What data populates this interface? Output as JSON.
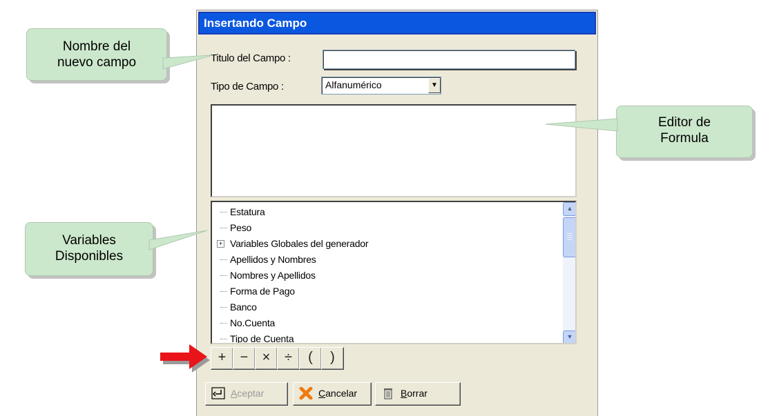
{
  "dialog": {
    "title": "Insertando Campo",
    "titulo_label": "Titulo del Campo :",
    "titulo_value": "",
    "tipo_label": "Tipo de Campo :",
    "tipo_value": "Alfanumérico",
    "variables": [
      {
        "label": "Estatura",
        "expandable": false
      },
      {
        "label": "Peso",
        "expandable": false
      },
      {
        "label": "Variables Globales del generador",
        "expandable": true
      },
      {
        "label": "Apellidos y Nombres",
        "expandable": false
      },
      {
        "label": "Nombres y Apellidos",
        "expandable": false
      },
      {
        "label": "Forma de Pago",
        "expandable": false
      },
      {
        "label": "Banco",
        "expandable": false
      },
      {
        "label": "No.Cuenta",
        "expandable": false
      },
      {
        "label": "Tipo de Cuenta",
        "expandable": false
      }
    ],
    "operators": [
      "+",
      "−",
      "×",
      "÷",
      "(",
      ")"
    ],
    "buttons": {
      "aceptar": {
        "label": "Aceptar",
        "accel": "A",
        "rest": "ceptar",
        "enabled": false
      },
      "cancelar": {
        "label": "Cancelar",
        "accel": "C",
        "rest": "ancelar"
      },
      "borrar": {
        "label": "Borrar",
        "accel": "B",
        "rest": "orrar"
      }
    }
  },
  "callouts": {
    "nombre_line1": "Nombre del",
    "nombre_line2": "nuevo campo",
    "editor_line1": "Editor de",
    "editor_line2": "Formula",
    "variables_line1": "Variables",
    "variables_line2": "Disponibles"
  },
  "colors": {
    "titlebar": "#0b58e0",
    "callout_fill": "#cce8cc",
    "arrow": "#e8141a",
    "dialog_bg": "#ece9d8"
  },
  "icons": [
    "chevron-down-icon",
    "scroll-up-icon",
    "scroll-down-icon",
    "enter-icon",
    "cancel-x-icon",
    "trash-icon",
    "red-arrow-icon"
  ]
}
